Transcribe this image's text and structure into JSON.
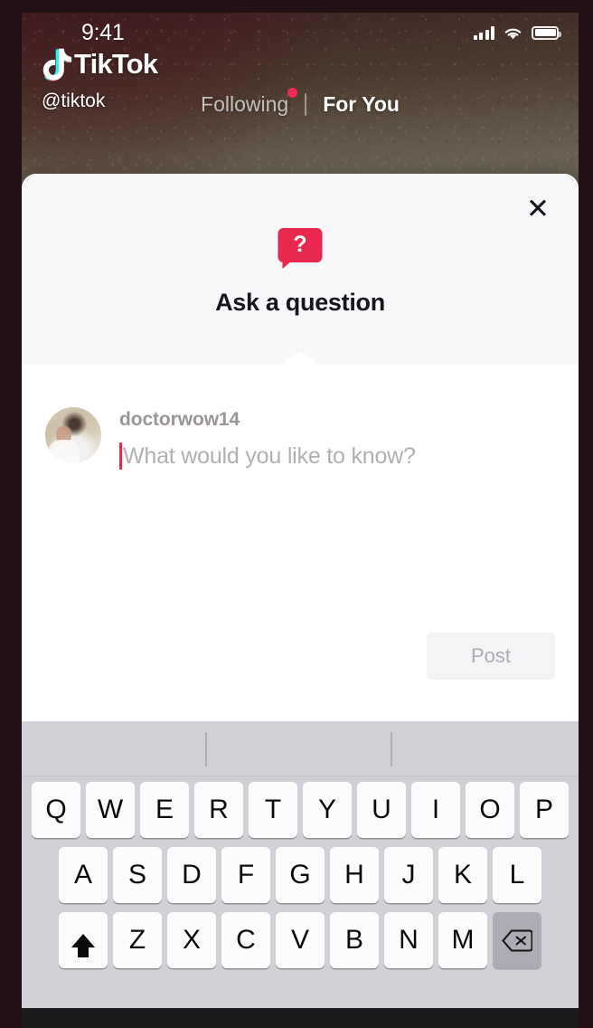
{
  "status_bar": {
    "time": "9:41",
    "signal_icon": "cellular-signal-icon",
    "wifi_icon": "wifi-icon",
    "battery_icon": "battery-icon"
  },
  "app": {
    "brand_name": "TikTok",
    "logo_icon": "tiktok-note-logo-icon",
    "handle": "@tiktok"
  },
  "feed_tabs": [
    {
      "label": "Following",
      "active": false,
      "has_dot": true
    },
    {
      "label": "For You",
      "active": true,
      "has_dot": false
    }
  ],
  "modal": {
    "close_icon": "close-icon",
    "header_icon": "question-bubble-icon",
    "header_icon_glyph": "?",
    "title": "Ask a question",
    "compose": {
      "username": "doctorwow14",
      "placeholder": "What would you like to know?",
      "value": "",
      "avatar_icon": "user-avatar"
    },
    "post_label": "Post",
    "post_enabled": false
  },
  "keyboard": {
    "predictive_suggestions": [
      "",
      "",
      ""
    ],
    "rows": [
      [
        "Q",
        "W",
        "E",
        "R",
        "T",
        "Y",
        "U",
        "I",
        "O",
        "P"
      ],
      [
        "A",
        "S",
        "D",
        "F",
        "G",
        "H",
        "J",
        "K",
        "L"
      ],
      [
        "Z",
        "X",
        "C",
        "V",
        "B",
        "N",
        "M"
      ]
    ],
    "shift_icon": "shift-arrow-icon",
    "delete_icon": "backspace-delete-icon"
  },
  "colors": {
    "accent_red": "#e8284f",
    "tab_dot": "#f02b55",
    "sheet_bg": "#ffffff",
    "sheet_header_bg": "#f8f7f9",
    "post_disabled_bg": "#f4f3f5",
    "post_disabled_text": "#b0abb1",
    "keyboard_bg": "#d1d0d7",
    "key_bg": "#fcfcfd",
    "delete_key_bg": "#adacb4",
    "placeholder_text": "#b3aeb3",
    "username_text": "#9a9499"
  }
}
